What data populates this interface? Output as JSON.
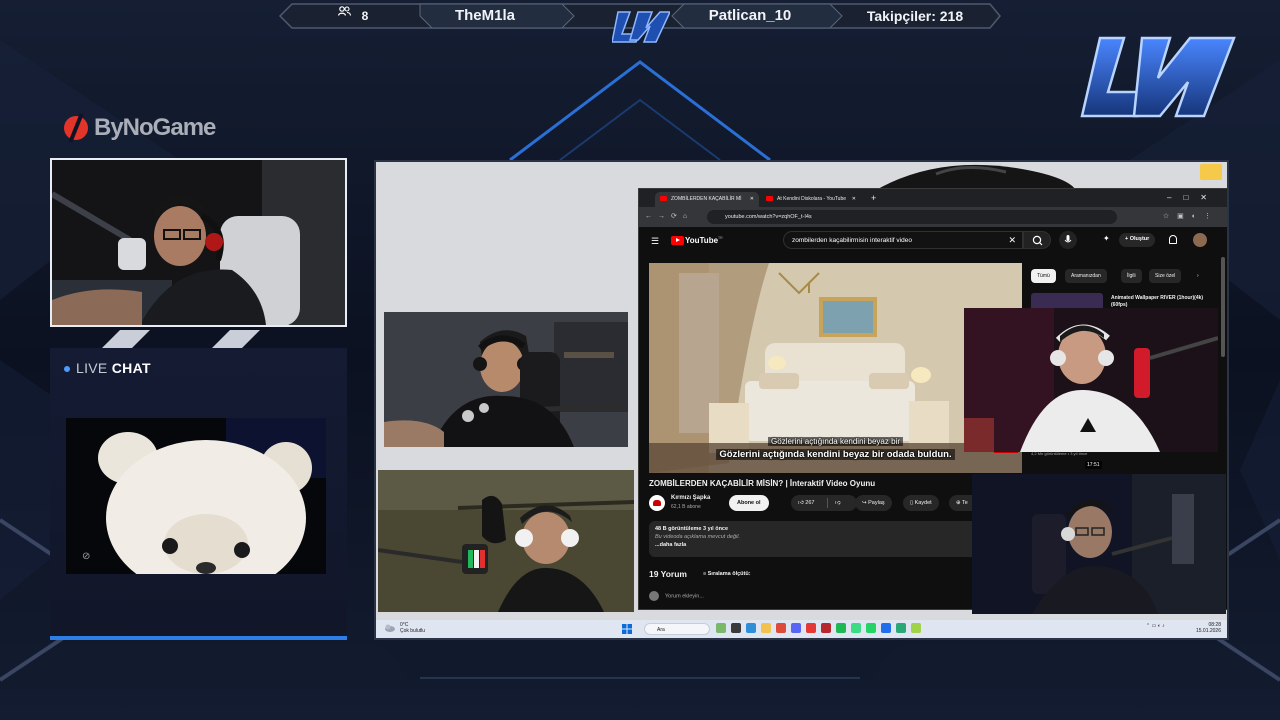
{
  "topbar": {
    "viewer_count": "8",
    "user_left": "TheM1la",
    "user_right": "Patlican_10",
    "followers": "Takipçiler: 218"
  },
  "sponsor": {
    "brand": "ByNoGame"
  },
  "live_chat": {
    "live": "LIVE",
    "chat": "CHAT"
  },
  "taskbar": {
    "temp": "0°C",
    "weather": "Çok bulutlu",
    "search": "Ara",
    "time": "08:28",
    "date": "15.01.2026"
  },
  "browser": {
    "tabs": [
      {
        "label": "ZOMBİLERDEN KAÇABİLİR Mİ"
      },
      {
        "label": "At Kendini Diskolara - YouTube"
      }
    ],
    "url": "youtube.com/watch?v=zqhOF_t-I4s"
  },
  "youtube": {
    "logo": "YouTube",
    "region": "TR",
    "search_value": "zombilerden kaçabilirmisin interaktif video",
    "create": "Oluştur",
    "subtitle_line1": "Gözlerini açtığında kendini beyaz bir",
    "subtitle_line2": "Gözlerini açtığında kendini beyaz bir odada buldun.",
    "badge": "ABONE OL",
    "video_title": "ZOMBİLERDEN KAÇABİLİR MİSİN? | İnteraktif Video Oyunu",
    "channel": "Kırmızı Şapka",
    "channel_subs": "62,1 B abone",
    "subscribe": "Abone ol",
    "likes": "267",
    "share": "Paylaş",
    "save": "Kaydet",
    "more": "Te",
    "desc_stats": "48 B görüntüleme  3 yıl önce",
    "desc_text": "Bu videoda açıklama mevcut değil.",
    "desc_more": "...daha fazla",
    "comments_count": "19 Yorum",
    "sort_label": "Sıralama ölçütü:",
    "add_comment": "Yorum ekleyin...",
    "chips": [
      "Tümü",
      "Aramanızdan",
      "İlgili",
      "Size özel"
    ],
    "rec_title": "Animated Wallpaper RIVER (1hour)(4k)(60fps)",
    "rec_views": "4,2 Mn görüntüleme • 3 yıl önce",
    "rec_duration": "17:51"
  }
}
